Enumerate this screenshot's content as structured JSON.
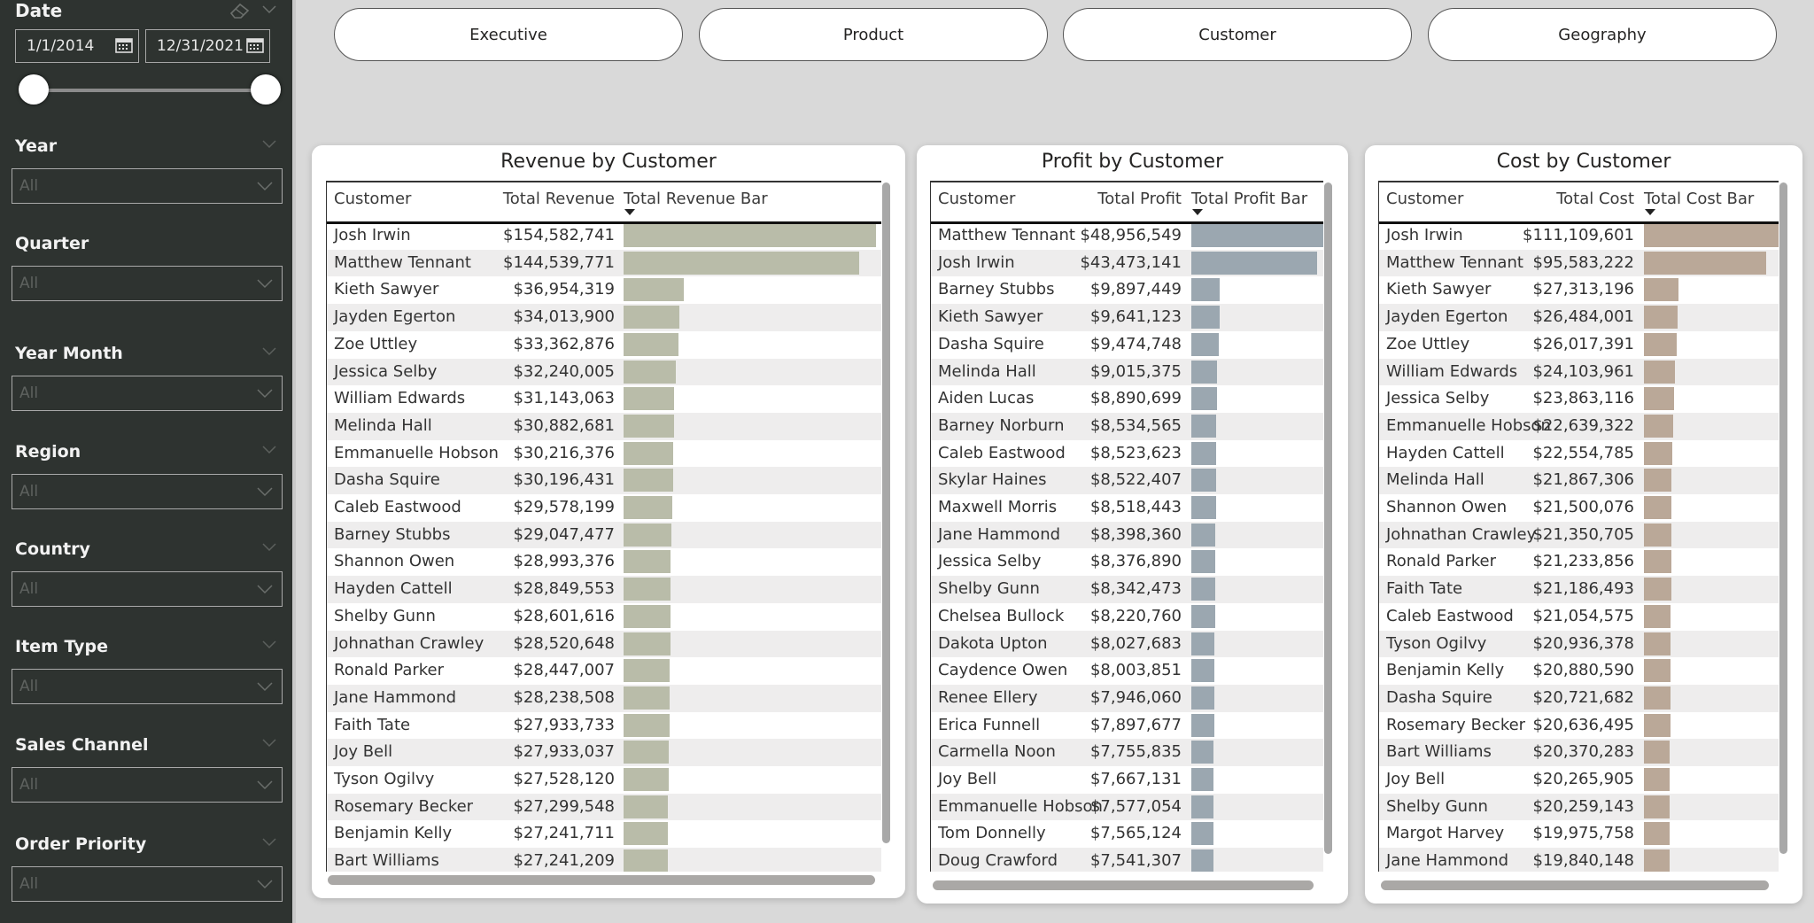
{
  "sidebar": {
    "date": {
      "title": "Date",
      "start": "1/1/2014",
      "end": "12/31/2021",
      "range_selected_fraction": [
        0.0,
        1.0
      ]
    },
    "slicers": [
      {
        "title": "Year",
        "value": "All"
      },
      {
        "title": "Quarter",
        "value": "All"
      },
      {
        "title": "Year Month",
        "value": "All"
      },
      {
        "title": "Region",
        "value": "All"
      },
      {
        "title": "Country",
        "value": "All"
      },
      {
        "title": "Item Type",
        "value": "All"
      },
      {
        "title": "Sales Channel",
        "value": "All"
      },
      {
        "title": "Order Priority",
        "value": "All"
      }
    ]
  },
  "nav": {
    "buttons": [
      {
        "label": "Executive"
      },
      {
        "label": "Product"
      },
      {
        "label": "Customer"
      },
      {
        "label": "Geography"
      }
    ]
  },
  "colors": {
    "revenue_bar": "#b9bca9",
    "profit_bar": "#9ba7b0",
    "cost_bar": "#baa898",
    "sidebar_bg": "#2e3330",
    "canvas_bg": "#d9d9d9"
  },
  "panels": {
    "revenue": {
      "title": "Revenue by Customer",
      "headers": [
        "Customer",
        "Total Revenue",
        "Total Revenue Bar"
      ],
      "max_value": 154582741,
      "rows": [
        {
          "customer": "Josh Irwin",
          "value": "$154,582,741",
          "raw": 154582741
        },
        {
          "customer": "Matthew Tennant",
          "value": "$144,539,771",
          "raw": 144539771
        },
        {
          "customer": "Kieth Sawyer",
          "value": "$36,954,319",
          "raw": 36954319
        },
        {
          "customer": "Jayden Egerton",
          "value": "$34,013,900",
          "raw": 34013900
        },
        {
          "customer": "Zoe Uttley",
          "value": "$33,362,876",
          "raw": 33362876
        },
        {
          "customer": "Jessica Selby",
          "value": "$32,240,005",
          "raw": 32240005
        },
        {
          "customer": "William Edwards",
          "value": "$31,143,063",
          "raw": 31143063
        },
        {
          "customer": "Melinda Hall",
          "value": "$30,882,681",
          "raw": 30882681
        },
        {
          "customer": "Emmanuelle Hobson",
          "value": "$30,216,376",
          "raw": 30216376
        },
        {
          "customer": "Dasha Squire",
          "value": "$30,196,431",
          "raw": 30196431
        },
        {
          "customer": "Caleb Eastwood",
          "value": "$29,578,199",
          "raw": 29578199
        },
        {
          "customer": "Barney Stubbs",
          "value": "$29,047,477",
          "raw": 29047477
        },
        {
          "customer": "Shannon Owen",
          "value": "$28,993,376",
          "raw": 28993376
        },
        {
          "customer": "Hayden Cattell",
          "value": "$28,849,553",
          "raw": 28849553
        },
        {
          "customer": "Shelby Gunn",
          "value": "$28,601,616",
          "raw": 28601616
        },
        {
          "customer": "Johnathan Crawley",
          "value": "$28,520,648",
          "raw": 28520648
        },
        {
          "customer": "Ronald Parker",
          "value": "$28,447,007",
          "raw": 28447007
        },
        {
          "customer": "Jane Hammond",
          "value": "$28,238,508",
          "raw": 28238508
        },
        {
          "customer": "Faith Tate",
          "value": "$27,933,733",
          "raw": 27933733
        },
        {
          "customer": "Joy Bell",
          "value": "$27,933,037",
          "raw": 27933037
        },
        {
          "customer": "Tyson Ogilvy",
          "value": "$27,528,120",
          "raw": 27528120
        },
        {
          "customer": "Rosemary Becker",
          "value": "$27,299,548",
          "raw": 27299548
        },
        {
          "customer": "Benjamin Kelly",
          "value": "$27,241,711",
          "raw": 27241711
        },
        {
          "customer": "Bart Williams",
          "value": "$27,241,209",
          "raw": 27241209
        }
      ]
    },
    "profit": {
      "title": "Profit by Customer",
      "headers": [
        "Customer",
        "Total Profit",
        "Total Profit Bar"
      ],
      "max_value": 48956549,
      "rows": [
        {
          "customer": "Matthew Tennant",
          "value": "$48,956,549",
          "raw": 48956549
        },
        {
          "customer": "Josh Irwin",
          "value": "$43,473,141",
          "raw": 43473141
        },
        {
          "customer": "Barney Stubbs",
          "value": "$9,897,449",
          "raw": 9897449
        },
        {
          "customer": "Kieth Sawyer",
          "value": "$9,641,123",
          "raw": 9641123
        },
        {
          "customer": "Dasha Squire",
          "value": "$9,474,748",
          "raw": 9474748
        },
        {
          "customer": "Melinda Hall",
          "value": "$9,015,375",
          "raw": 9015375
        },
        {
          "customer": "Aiden Lucas",
          "value": "$8,890,699",
          "raw": 8890699
        },
        {
          "customer": "Barney Norburn",
          "value": "$8,534,565",
          "raw": 8534565
        },
        {
          "customer": "Caleb Eastwood",
          "value": "$8,523,623",
          "raw": 8523623
        },
        {
          "customer": "Skylar Haines",
          "value": "$8,522,407",
          "raw": 8522407
        },
        {
          "customer": "Maxwell Morris",
          "value": "$8,518,443",
          "raw": 8518443
        },
        {
          "customer": "Jane Hammond",
          "value": "$8,398,360",
          "raw": 8398360
        },
        {
          "customer": "Jessica Selby",
          "value": "$8,376,890",
          "raw": 8376890
        },
        {
          "customer": "Shelby Gunn",
          "value": "$8,342,473",
          "raw": 8342473
        },
        {
          "customer": "Chelsea Bullock",
          "value": "$8,220,760",
          "raw": 8220760
        },
        {
          "customer": "Dakota Upton",
          "value": "$8,027,683",
          "raw": 8027683
        },
        {
          "customer": "Caydence Owen",
          "value": "$8,003,851",
          "raw": 8003851
        },
        {
          "customer": "Renee Ellery",
          "value": "$7,946,060",
          "raw": 7946060
        },
        {
          "customer": "Erica Funnell",
          "value": "$7,897,677",
          "raw": 7897677
        },
        {
          "customer": "Carmella Noon",
          "value": "$7,755,835",
          "raw": 7755835
        },
        {
          "customer": "Joy Bell",
          "value": "$7,667,131",
          "raw": 7667131
        },
        {
          "customer": "Emmanuelle Hobson",
          "value": "$7,577,054",
          "raw": 7577054
        },
        {
          "customer": "Tom Donnelly",
          "value": "$7,565,124",
          "raw": 7565124
        },
        {
          "customer": "Doug Crawford",
          "value": "$7,541,307",
          "raw": 7541307
        }
      ]
    },
    "cost": {
      "title": "Cost by Customer",
      "headers": [
        "Customer",
        "Total Cost",
        "Total Cost Bar"
      ],
      "max_value": 111109601,
      "rows": [
        {
          "customer": "Josh Irwin",
          "value": "$111,109,601",
          "raw": 111109601
        },
        {
          "customer": "Matthew Tennant",
          "value": "$95,583,222",
          "raw": 95583222
        },
        {
          "customer": "Kieth Sawyer",
          "value": "$27,313,196",
          "raw": 27313196
        },
        {
          "customer": "Jayden Egerton",
          "value": "$26,484,001",
          "raw": 26484001
        },
        {
          "customer": "Zoe Uttley",
          "value": "$26,017,391",
          "raw": 26017391
        },
        {
          "customer": "William Edwards",
          "value": "$24,103,961",
          "raw": 24103961
        },
        {
          "customer": "Jessica Selby",
          "value": "$23,863,116",
          "raw": 23863116
        },
        {
          "customer": "Emmanuelle Hobson",
          "value": "$22,639,322",
          "raw": 22639322
        },
        {
          "customer": "Hayden Cattell",
          "value": "$22,554,785",
          "raw": 22554785
        },
        {
          "customer": "Melinda Hall",
          "value": "$21,867,306",
          "raw": 21867306
        },
        {
          "customer": "Shannon Owen",
          "value": "$21,500,076",
          "raw": 21500076
        },
        {
          "customer": "Johnathan Crawley",
          "value": "$21,350,705",
          "raw": 21350705
        },
        {
          "customer": "Ronald Parker",
          "value": "$21,233,856",
          "raw": 21233856
        },
        {
          "customer": "Faith Tate",
          "value": "$21,186,493",
          "raw": 21186493
        },
        {
          "customer": "Caleb Eastwood",
          "value": "$21,054,575",
          "raw": 21054575
        },
        {
          "customer": "Tyson Ogilvy",
          "value": "$20,936,378",
          "raw": 20936378
        },
        {
          "customer": "Benjamin Kelly",
          "value": "$20,880,590",
          "raw": 20880590
        },
        {
          "customer": "Dasha Squire",
          "value": "$20,721,682",
          "raw": 20721682
        },
        {
          "customer": "Rosemary Becker",
          "value": "$20,636,495",
          "raw": 20636495
        },
        {
          "customer": "Bart Williams",
          "value": "$20,370,283",
          "raw": 20370283
        },
        {
          "customer": "Joy Bell",
          "value": "$20,265,905",
          "raw": 20265905
        },
        {
          "customer": "Shelby Gunn",
          "value": "$20,259,143",
          "raw": 20259143
        },
        {
          "customer": "Margot Harvey",
          "value": "$19,975,758",
          "raw": 19975758
        },
        {
          "customer": "Jane Hammond",
          "value": "$19,840,148",
          "raw": 19840148
        }
      ]
    }
  }
}
